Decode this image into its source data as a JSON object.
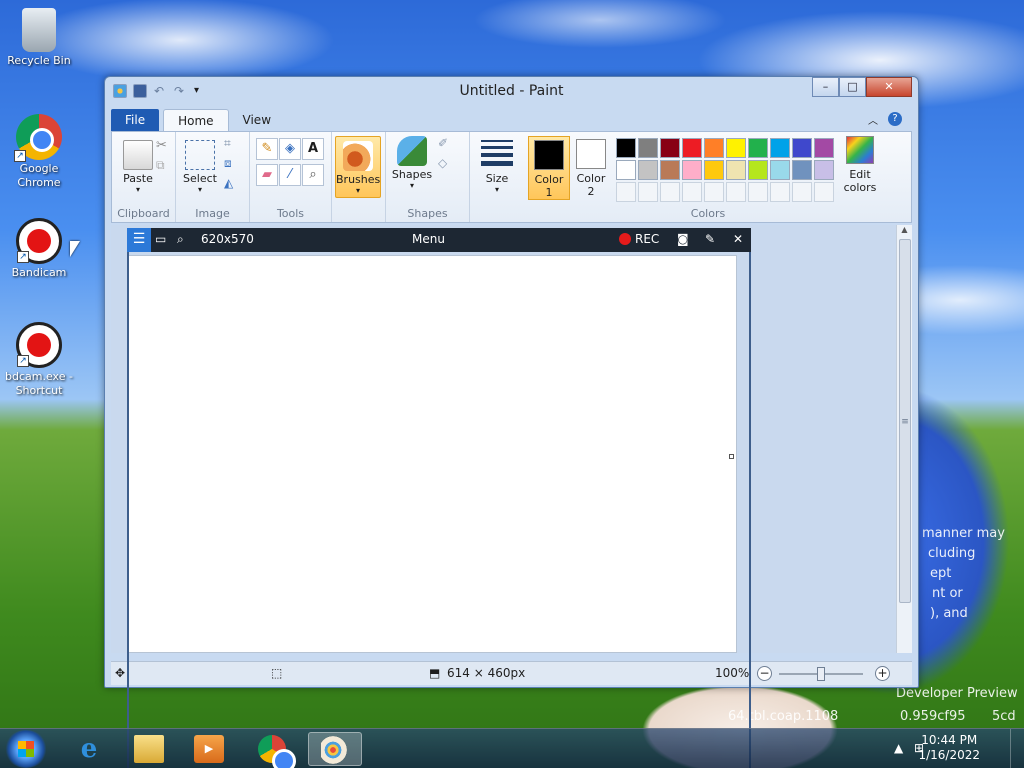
{
  "desktop": {
    "icons": [
      {
        "label": "Recycle Bin"
      },
      {
        "label": "Google Chrome"
      },
      {
        "label": "Bandicam"
      },
      {
        "label": "bdcam.exe - Shortcut"
      }
    ],
    "watermark_lines": [
      "manner may",
      "cluding",
      "ept",
      "nt or",
      "), and",
      "Developer Preview",
      "64.tbl.coap.1108",
      "0.959cf95",
      "5cd"
    ]
  },
  "paint": {
    "title": "Untitled - Paint",
    "tabs": [
      "File",
      "Home",
      "View"
    ],
    "active_tab": "Home",
    "groups": {
      "clipboard": {
        "label": "Clipboard",
        "paste": "Paste"
      },
      "image": {
        "label": "Image",
        "select": "Select"
      },
      "tools": {
        "label": "Tools"
      },
      "brushes": {
        "label": "Brushes"
      },
      "shapes": {
        "label": "Shapes",
        "shapes_btn": "Shapes"
      },
      "size": {
        "label": "Size"
      },
      "colors": {
        "label": "Colors",
        "color1": "Color 1",
        "color1_line1": "Color",
        "color1_line2": "1",
        "color2_line1": "Color",
        "color2_line2": "2",
        "edit_line1": "Edit",
        "edit_line2": "colors"
      }
    },
    "palette_row1": [
      "#000000",
      "#7f7f7f",
      "#880015",
      "#ed1c24",
      "#ff7f27",
      "#fff200",
      "#22b14c",
      "#00a2e8",
      "#3f48cc",
      "#a349a4"
    ],
    "palette_row2": [
      "#ffffff",
      "#c3c3c3",
      "#b97a57",
      "#ffaec9",
      "#ffc90e",
      "#efe4b0",
      "#b5e61d",
      "#99d9ea",
      "#7092be",
      "#c8bfe7"
    ],
    "color1_value": "#000000",
    "color2_value": "#ffffff",
    "status": {
      "canvas_size": "614 × 460px",
      "zoom": "100%"
    }
  },
  "bandicam": {
    "dimensions": "620x570",
    "menu": "Menu",
    "rec": "REC"
  },
  "taskbar": {
    "time": "10:44 PM",
    "date": "1/16/2022"
  }
}
